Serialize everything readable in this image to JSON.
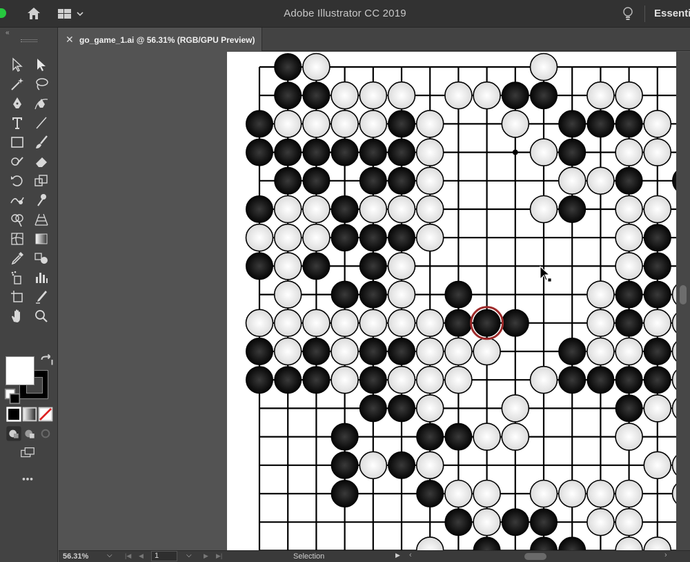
{
  "app": {
    "title": "Adobe Illustrator CC 2019",
    "workspace": "Essenti"
  },
  "document": {
    "tab_label": "go_game_1.ai @ 56.31% (RGB/GPU Preview)",
    "close_glyph": "✕"
  },
  "status_bar": {
    "zoom": "56.31%",
    "page": "1",
    "mode": "Selection"
  },
  "tools": [
    {
      "name": "selection-tool-icon"
    },
    {
      "name": "direct-selection-tool-icon"
    },
    {
      "name": "magic-wand-tool-icon"
    },
    {
      "name": "lasso-tool-icon"
    },
    {
      "name": "pen-tool-icon"
    },
    {
      "name": "curvature-tool-icon"
    },
    {
      "name": "type-tool-icon"
    },
    {
      "name": "line-tool-icon"
    },
    {
      "name": "rectangle-tool-icon"
    },
    {
      "name": "paintbrush-tool-icon"
    },
    {
      "name": "shaper-tool-icon"
    },
    {
      "name": "eraser-tool-icon"
    },
    {
      "name": "rotate-tool-icon"
    },
    {
      "name": "scale-tool-icon"
    },
    {
      "name": "warp-tool-icon"
    },
    {
      "name": "puppet-warp-tool-icon"
    },
    {
      "name": "shape-builder-tool-icon"
    },
    {
      "name": "perspective-grid-tool-icon"
    },
    {
      "name": "mesh-tool-icon"
    },
    {
      "name": "gradient-tool-icon"
    },
    {
      "name": "eyedropper-tool-icon"
    },
    {
      "name": "blend-tool-icon"
    },
    {
      "name": "symbol-sprayer-tool-icon"
    },
    {
      "name": "column-graph-tool-icon"
    },
    {
      "name": "artboard-tool-icon"
    },
    {
      "name": "slice-tool-icon"
    },
    {
      "name": "hand-tool-icon"
    },
    {
      "name": "zoom-tool-icon"
    }
  ],
  "colors": {
    "fill": "#ffffff",
    "stroke": "#000000",
    "highlight_ring": "#9e2a2a"
  },
  "go_board": {
    "last_move": {
      "col": 8,
      "row": 9
    },
    "stones": [
      "-BW-------W-----",
      "-BBWWW-WWBB-WW--",
      "BWWWWBW--W-BBBW-",
      "BBBBBBW---WB-WW-",
      "-BB-BBW----WWB-B",
      "BWWBWWW---WB-WW-",
      "WWWBBBW------WB-",
      "BWB-BW-------WB-",
      "-W-BBW-B----WBBW",
      "WWWWWWWBBB--WBWW",
      "BWBWBBWWW--BWWBW",
      "BBBWBWWW--WBBBBW",
      "----BBW--W---BWW",
      "---B--BBWW---W--",
      "---BWBW-------WW",
      "---B--BWW-WWWW-W",
      "-------BWBB-WW--",
      "------W-B-BB-WW-"
    ],
    "hoshi": [
      [
        9,
        3
      ]
    ]
  }
}
